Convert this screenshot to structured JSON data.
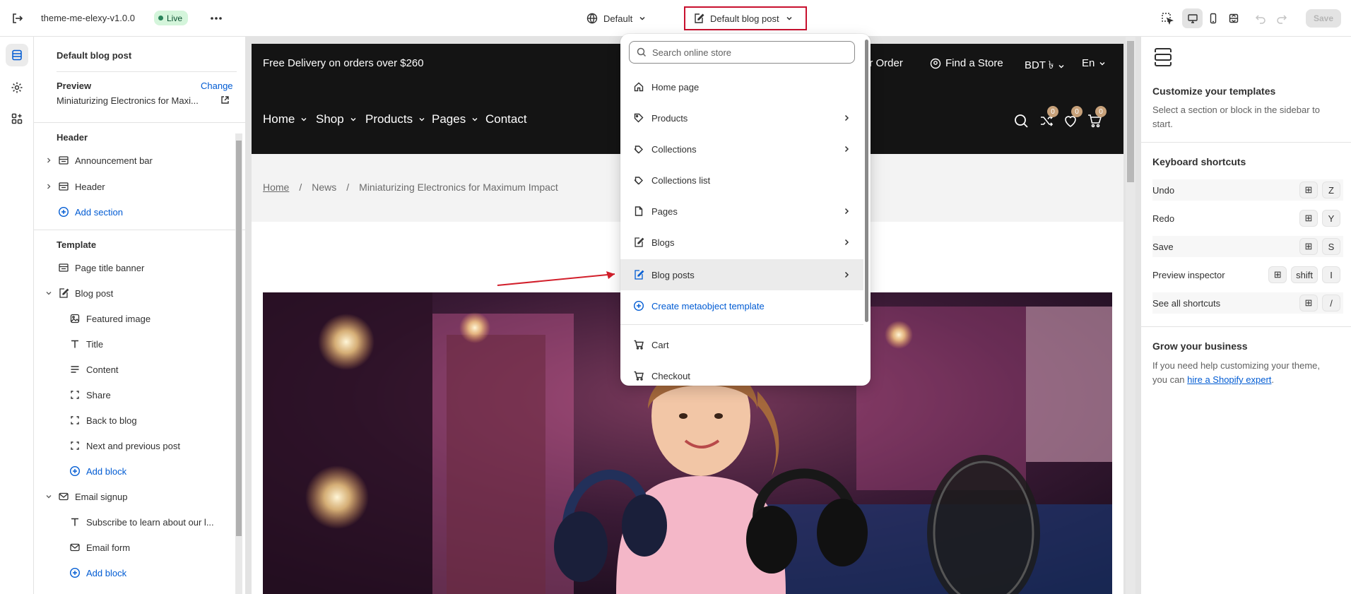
{
  "topbar": {
    "theme_name": "theme-me-elexy-v1.0.0",
    "status": "Live",
    "market": "Default",
    "template": "Default blog post",
    "save_label": "Save"
  },
  "sidebar": {
    "title": "Default blog post",
    "preview_label": "Preview",
    "change_label": "Change",
    "preview_value": "Miniaturizing Electronics for Maxi...",
    "header_section": "Header",
    "header_items": [
      "Announcement bar",
      "Header"
    ],
    "add_section": "Add section",
    "template_section": "Template",
    "template_items": {
      "page_title_banner": "Page title banner",
      "blog_post": "Blog post",
      "blog_post_blocks": [
        "Featured image",
        "Title",
        "Content",
        "Share",
        "Back to blog",
        "Next and previous post"
      ],
      "add_block_1": "Add block",
      "email_signup": "Email signup",
      "email_signup_blocks": [
        "Subscribe to learn about our l...",
        "Email form"
      ],
      "add_block_2": "Add block"
    }
  },
  "store": {
    "promo": "Free Delivery on orders over $260",
    "track_order": "ur Order",
    "find_store": "Find a Store",
    "currency": "BDT ৳",
    "language": "En",
    "nav": [
      "Home",
      "Shop",
      "Products",
      "Pages",
      "Contact"
    ],
    "badges": [
      "0",
      "0",
      "0"
    ],
    "breadcrumb": [
      "Home",
      "/",
      "News",
      "/",
      "Miniaturizing Electronics for Maximum Impact"
    ]
  },
  "dropdown": {
    "search_placeholder": "Search online store",
    "items": [
      "Home page",
      "Products",
      "Collections",
      "Collections list",
      "Pages",
      "Blogs",
      "Blog posts"
    ],
    "create_label": "Create metaobject template",
    "bottom_items": [
      "Cart",
      "Checkout"
    ]
  },
  "right_panel": {
    "title": "Customize your templates",
    "desc": "Select a section or block in the sidebar to start.",
    "shortcuts_title": "Keyboard shortcuts",
    "shortcuts": [
      {
        "label": "Undo",
        "key": "Z"
      },
      {
        "label": "Redo",
        "key": "Y"
      },
      {
        "label": "Save",
        "key": "S"
      },
      {
        "label": "Preview inspector",
        "mod": "shift",
        "key": "I"
      },
      {
        "label": "See all shortcuts",
        "key": "/"
      }
    ],
    "grow_title": "Grow your business",
    "grow_text_1": "If you need help customizing your theme, you can",
    "grow_link": "hire a Shopify expert",
    "grow_text_2": "."
  },
  "colors": {
    "accent_link": "#005bd3",
    "live_badge": "#d4f5db",
    "highlight_border": "#c8102e",
    "store_header": "#141414",
    "cart_badge": "#c7a17a"
  }
}
